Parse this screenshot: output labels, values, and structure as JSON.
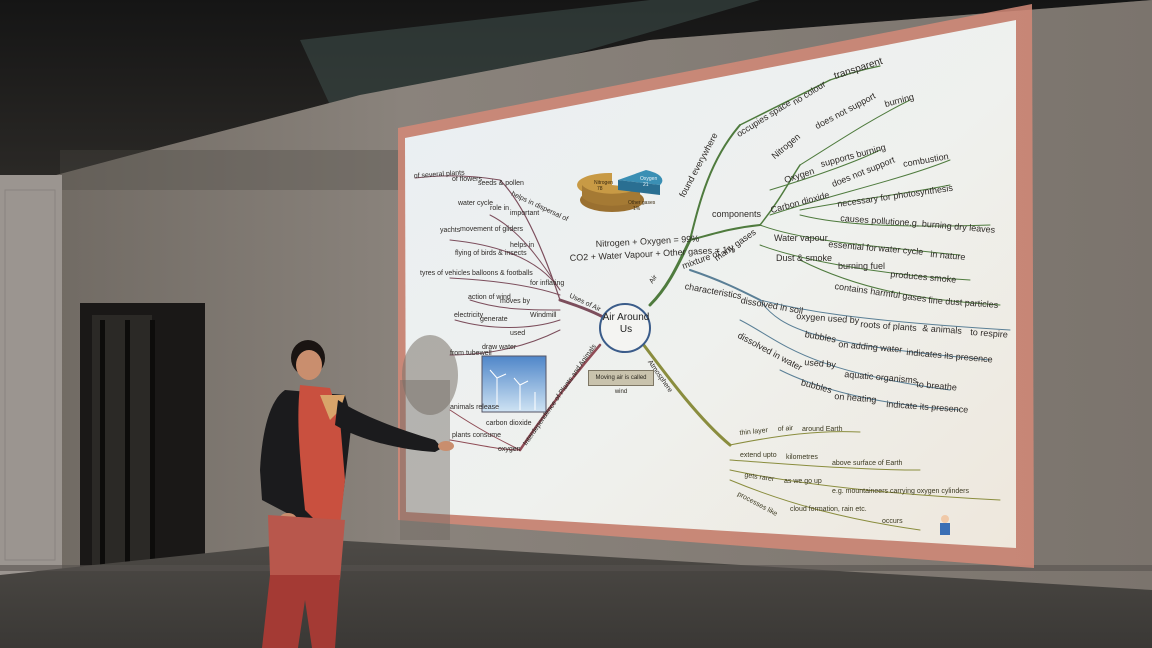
{
  "slide": {
    "center_title": "Air Around Us",
    "pie_labels": [
      "Nitrogen",
      "Oxygen",
      "Other gases"
    ],
    "pie_percent": [
      "78",
      "21",
      "1%"
    ],
    "formula_line1": "Nitrogen + Oxygen = 99%",
    "formula_line2": "CO2 + Water Vapour + Other gases = 1%",
    "caption": "Moving air is called wind",
    "branches": {
      "uses_of_air": "Uses of Air",
      "interdependence": "Interdependence of Plants and Animals",
      "air": "Air",
      "atmosphere": "Atmosphere",
      "found_everywhere": "found everywhere",
      "mixture_of": "mixture of",
      "characteristics": "characteristics"
    },
    "left_labels": [
      "of several plants",
      "of flowers",
      "seeds & pollen",
      "helps in dispersal of",
      "water cycle",
      "role in",
      "important",
      "yachts",
      "movement of gliders",
      "flying of birds & insects",
      "helps in",
      "tyres of vehicles",
      "balloons & footballs",
      "for inflating",
      "action of wind",
      "moves by",
      "Windmill",
      "electricity",
      "generate",
      "used",
      "from tubewell",
      "draw water",
      "animals release",
      "carbon dioxide",
      "plants consume",
      "oxygen"
    ],
    "right_labels": [
      "occupies space",
      "no colour",
      "transparent",
      "Nitrogen",
      "does not support",
      "burning",
      "Oxygen",
      "supports burning",
      "Carbon dioxide",
      "does not support",
      "combustion",
      "necessary for",
      "photosynthesis",
      "causes pollution",
      "e.g. burning dry leaves",
      "components",
      "many gases",
      "Water vapour",
      "essential for",
      "water cycle",
      "in nature",
      "Dust & smoke",
      "burning fuel",
      "produces smoke",
      "contains harmful gases",
      "fine dust particles",
      "dissolved in soil",
      "oxygen used by",
      "roots of plants",
      "& animals",
      "to respire",
      "bubbles",
      "on adding water",
      "indicates its presence",
      "dissolved in water",
      "used by",
      "aquatic organisms",
      "to breathe",
      "bubbles",
      "on heating",
      "indicate its presence",
      "thin layer",
      "of air",
      "around Earth",
      "extend upto",
      "kilometres",
      "above surface of Earth",
      "gets rarer",
      "as we go up",
      "e.g. mountaineers carrying oxygen cylinders",
      "processes like",
      "cloud formation, rain etc.",
      "occurs"
    ]
  }
}
